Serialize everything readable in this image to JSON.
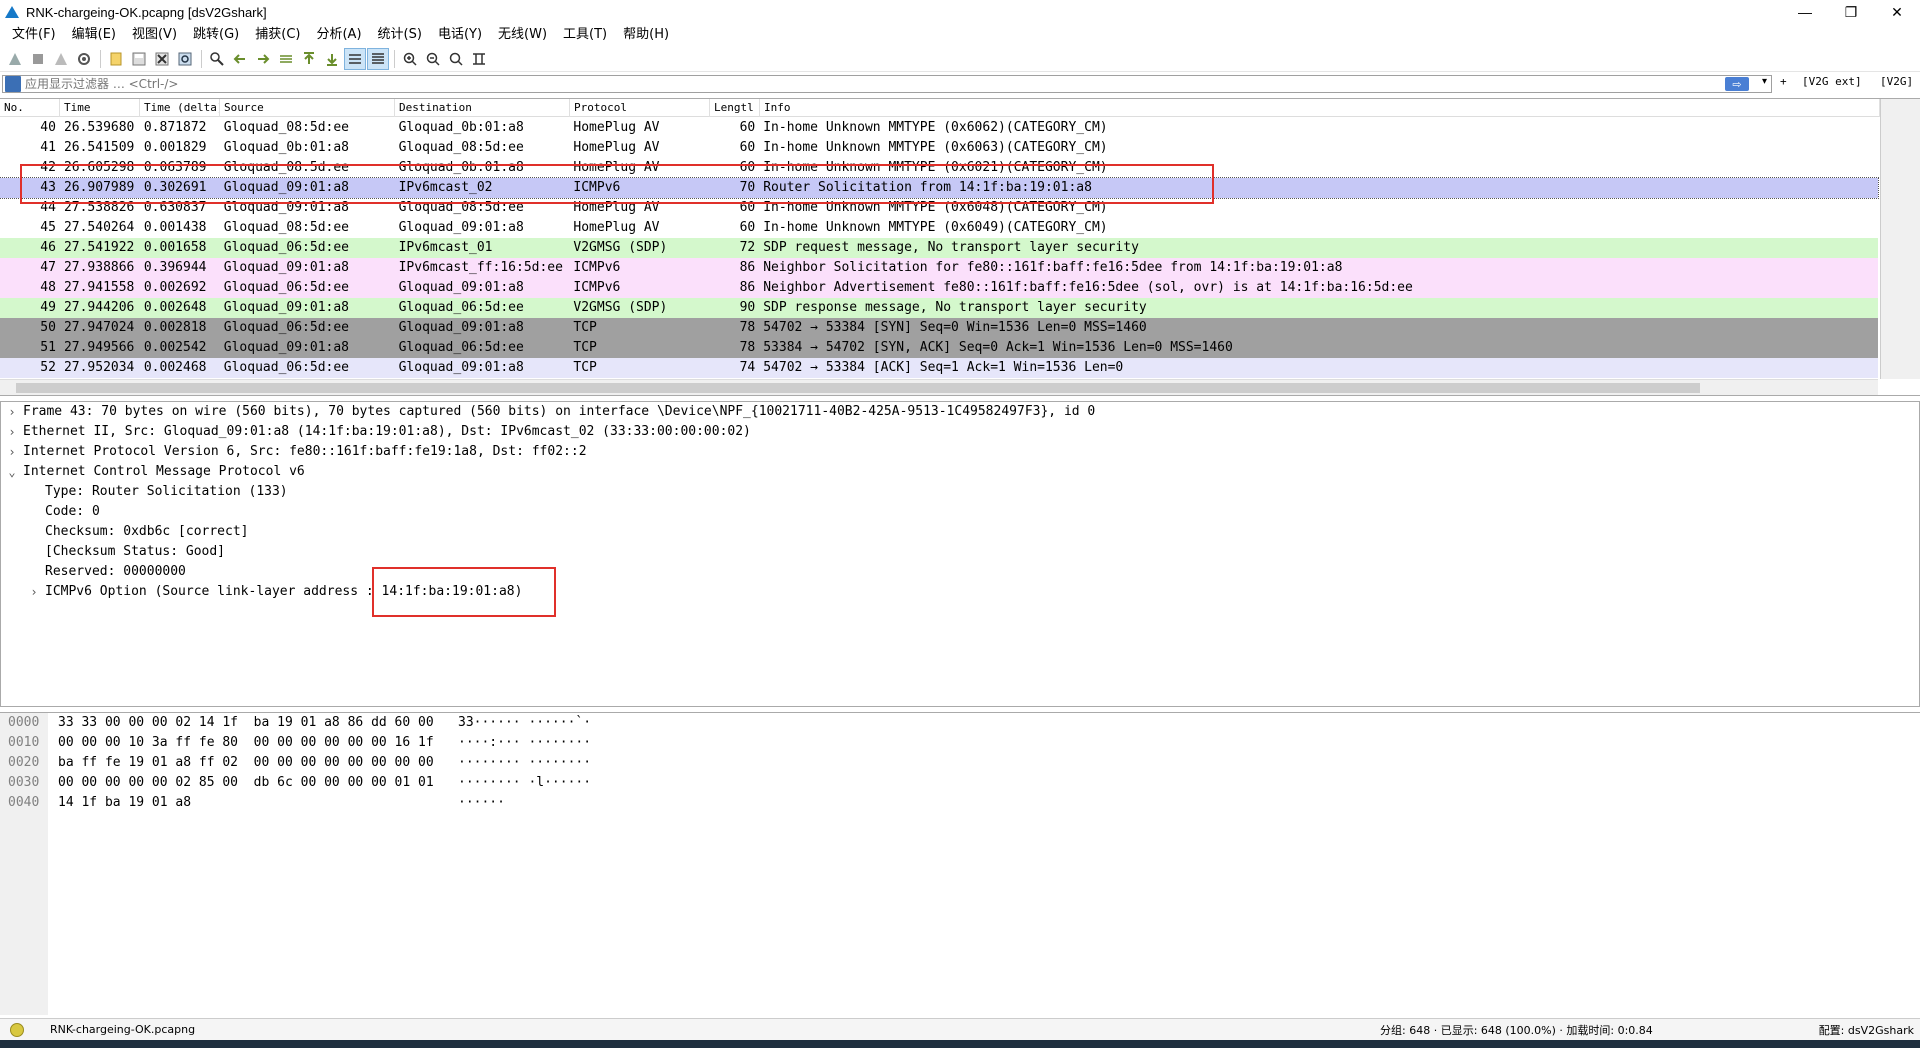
{
  "window": {
    "title": "RNK-chargeing-OK.pcapng [dsV2Gshark]",
    "buttons": [
      "—",
      "❐",
      "✕"
    ]
  },
  "menu": [
    "文件(F)",
    "编辑(E)",
    "视图(V)",
    "跳转(G)",
    "捕获(C)",
    "分析(A)",
    "统计(S)",
    "电话(Y)",
    "无线(W)",
    "工具(T)",
    "帮助(H)"
  ],
  "filter": {
    "placeholder": "应用显示过滤器 … <Ctrl-/>",
    "plus": "+",
    "btn1": "[V2G ext]",
    "btn2": "[V2G]"
  },
  "packet_list": {
    "columns": [
      "No.",
      "Time",
      "Time (delta)",
      "Source",
      "Destination",
      "Protocol",
      "Lengtl",
      "Info"
    ],
    "rows": [
      {
        "no": "40",
        "time": "26.539680",
        "delta": "0.871872",
        "src": "Gloquad_08:5d:ee",
        "dst": "Gloquad_0b:01:a8",
        "proto": "HomePlug AV",
        "len": "60",
        "info": "In-home Unknown MMTYPE (0x6062)(CATEGORY_CM)",
        "style": "homeplug"
      },
      {
        "no": "41",
        "time": "26.541509",
        "delta": "0.001829",
        "src": "Gloquad_0b:01:a8",
        "dst": "Gloquad_08:5d:ee",
        "proto": "HomePlug AV",
        "len": "60",
        "info": "In-home Unknown MMTYPE (0x6063)(CATEGORY_CM)",
        "style": "homeplug"
      },
      {
        "no": "42",
        "time": "26.605298",
        "delta": "0.063789",
        "src": "Gloquad_08:5d:ee",
        "dst": "Gloquad_0b:01:a8",
        "proto": "HomePlug AV",
        "len": "60",
        "info": "In-home Unknown MMTYPE (0x6021)(CATEGORY_CM)",
        "style": "homeplug"
      },
      {
        "no": "43",
        "time": "26.907989",
        "delta": "0.302691",
        "src": "Gloquad_09:01:a8",
        "dst": "IPv6mcast_02",
        "proto": "ICMPv6",
        "len": "70",
        "info": "Router Solicitation from 14:1f:ba:19:01:a8",
        "style": "selected"
      },
      {
        "no": "44",
        "time": "27.538826",
        "delta": "0.630837",
        "src": "Gloquad_09:01:a8",
        "dst": "Gloquad_08:5d:ee",
        "proto": "HomePlug AV",
        "len": "60",
        "info": "In-home Unknown MMTYPE (0x6048)(CATEGORY_CM)",
        "style": "homeplug"
      },
      {
        "no": "45",
        "time": "27.540264",
        "delta": "0.001438",
        "src": "Gloquad_08:5d:ee",
        "dst": "Gloquad_09:01:a8",
        "proto": "HomePlug AV",
        "len": "60",
        "info": "In-home Unknown MMTYPE (0x6049)(CATEGORY_CM)",
        "style": "homeplug"
      },
      {
        "no": "46",
        "time": "27.541922",
        "delta": "0.001658",
        "src": "Gloquad_06:5d:ee",
        "dst": "IPv6mcast_01",
        "proto": "V2GMSG (SDP)",
        "len": "72",
        "info": "SDP request message, No transport layer security",
        "style": "v2g"
      },
      {
        "no": "47",
        "time": "27.938866",
        "delta": "0.396944",
        "src": "Gloquad_09:01:a8",
        "dst": "IPv6mcast_ff:16:5d:ee",
        "proto": "ICMPv6",
        "len": "86",
        "info": "Neighbor Solicitation for fe80::161f:baff:fe16:5dee from 14:1f:ba:19:01:a8",
        "style": "icmp"
      },
      {
        "no": "48",
        "time": "27.941558",
        "delta": "0.002692",
        "src": "Gloquad_06:5d:ee",
        "dst": "Gloquad_09:01:a8",
        "proto": "ICMPv6",
        "len": "86",
        "info": "Neighbor Advertisement fe80::161f:baff:fe16:5dee (sol, ovr) is at 14:1f:ba:16:5d:ee",
        "style": "icmp"
      },
      {
        "no": "49",
        "time": "27.944206",
        "delta": "0.002648",
        "src": "Gloquad_09:01:a8",
        "dst": "Gloquad_06:5d:ee",
        "proto": "V2GMSG (SDP)",
        "len": "90",
        "info": "SDP response message, No transport layer security",
        "style": "v2g"
      },
      {
        "no": "50",
        "time": "27.947024",
        "delta": "0.002818",
        "src": "Gloquad_06:5d:ee",
        "dst": "Gloquad_09:01:a8",
        "proto": "TCP",
        "len": "78",
        "info": "54702 → 53384 [SYN] Seq=0 Win=1536 Len=0 MSS=1460",
        "style": "tcp-syn"
      },
      {
        "no": "51",
        "time": "27.949566",
        "delta": "0.002542",
        "src": "Gloquad_09:01:a8",
        "dst": "Gloquad_06:5d:ee",
        "proto": "TCP",
        "len": "78",
        "info": "53384 → 54702 [SYN, ACK] Seq=0 Ack=1 Win=1536 Len=0 MSS=1460",
        "style": "tcp-syn"
      },
      {
        "no": "52",
        "time": "27.952034",
        "delta": "0.002468",
        "src": "Gloquad_06:5d:ee",
        "dst": "Gloquad_09:01:a8",
        "proto": "TCP",
        "len": "74",
        "info": "54702 → 53384 [ACK] Seq=1 Ack=1 Win=1536 Len=0",
        "style": "tcp"
      }
    ]
  },
  "details": [
    {
      "text": "Frame 43: 70 bytes on wire (560 bits), 70 bytes captured (560 bits) on interface \\Device\\NPF_{10021711-40B2-425A-9513-1C49582497F3}, id 0",
      "arrow": "›",
      "level": 0
    },
    {
      "text": "Ethernet II, Src: Gloquad_09:01:a8 (14:1f:ba:19:01:a8), Dst: IPv6mcast_02 (33:33:00:00:00:02)",
      "arrow": "›",
      "level": 0
    },
    {
      "text": "Internet Protocol Version 6, Src: fe80::161f:baff:fe19:1a8, Dst: ff02::2",
      "arrow": "›",
      "level": 0
    },
    {
      "text": "Internet Control Message Protocol v6",
      "arrow": "⌄",
      "level": 0
    },
    {
      "text": "Type: Router Solicitation (133)",
      "arrow": "",
      "level": 1
    },
    {
      "text": "Code: 0",
      "arrow": "",
      "level": 1
    },
    {
      "text": "Checksum: 0xdb6c [correct]",
      "arrow": "",
      "level": 1
    },
    {
      "text": "[Checksum Status: Good]",
      "arrow": "",
      "level": 1
    },
    {
      "text": "Reserved: 00000000",
      "arrow": "",
      "level": 1
    },
    {
      "text": "ICMPv6 Option (Source link-layer address : 14:1f:ba:19:01:a8)",
      "arrow": "›",
      "level": 1
    }
  ],
  "bytes": [
    {
      "off": "0000",
      "hex": "33 33 00 00 00 02 14 1f  ba 19 01 a8 86 dd 60 00",
      "ascii": "33······ ······`·"
    },
    {
      "off": "0010",
      "hex": "00 00 00 10 3a ff fe 80  00 00 00 00 00 00 16 1f",
      "ascii": "····:··· ········"
    },
    {
      "off": "0020",
      "hex": "ba ff fe 19 01 a8 ff 02  00 00 00 00 00 00 00 00",
      "ascii": "········ ········"
    },
    {
      "off": "0030",
      "hex": "00 00 00 00 00 02 85 00  db 6c 00 00 00 00 01 01",
      "ascii": "········ ·l······"
    },
    {
      "off": "0040",
      "hex": "14 1f ba 19 01 a8",
      "ascii": "······"
    }
  ],
  "status": {
    "file": "RNK-chargeing-OK.pcapng",
    "stats": "分组: 648 · 已显示: 648 (100.0%) · 加载时间: 0:0.84",
    "profile": "配置: dsV2Gshark"
  },
  "colors": {
    "selected": "#c6c8f6",
    "v2g": "#d4f8cc",
    "icmp": "#fbe0fb",
    "tcp_syn": "#a0a0a0",
    "tcp": "#e6e6fa",
    "highlight_box": "#e0302a"
  }
}
